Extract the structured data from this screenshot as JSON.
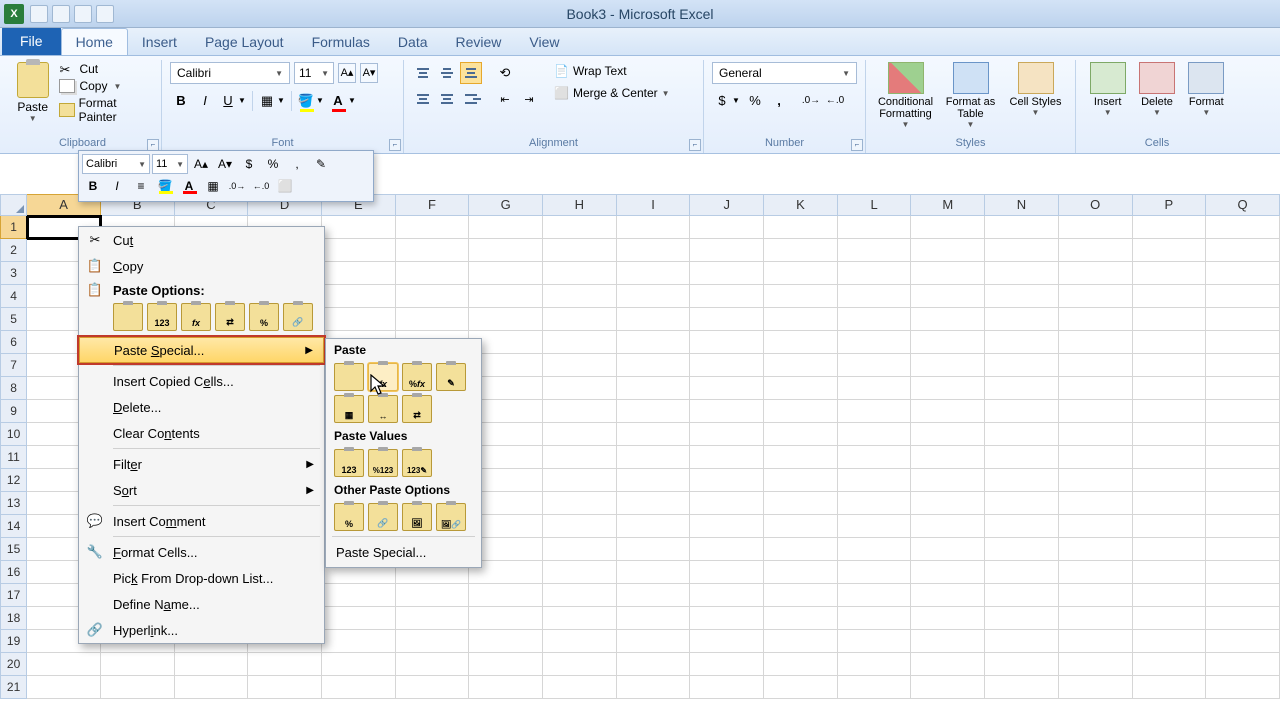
{
  "title": "Book3 - Microsoft Excel",
  "tabs": {
    "file": "File",
    "home": "Home",
    "insert": "Insert",
    "page_layout": "Page Layout",
    "formulas": "Formulas",
    "data": "Data",
    "review": "Review",
    "view": "View"
  },
  "ribbon": {
    "clipboard": {
      "label": "Clipboard",
      "paste": "Paste",
      "cut": "Cut",
      "copy": "Copy",
      "format_painter": "Format Painter"
    },
    "font": {
      "label": "Font",
      "name": "Calibri",
      "size": "11"
    },
    "alignment": {
      "label": "Alignment",
      "wrap": "Wrap Text",
      "merge": "Merge & Center"
    },
    "number": {
      "label": "Number",
      "format": "General"
    },
    "styles": {
      "label": "Styles",
      "cf": "Conditional Formatting",
      "ft": "Format as Table",
      "cs": "Cell Styles"
    },
    "cells": {
      "label": "Cells",
      "insert": "Insert",
      "delete": "Delete",
      "format": "Format"
    }
  },
  "mini_toolbar": {
    "font": "Calibri",
    "size": "11"
  },
  "columns": [
    "A",
    "B",
    "C",
    "D",
    "E",
    "F",
    "G",
    "H",
    "I",
    "J",
    "K",
    "L",
    "M",
    "N",
    "O",
    "P",
    "Q"
  ],
  "rows": [
    1,
    2,
    3,
    4,
    5,
    6,
    7,
    8,
    9,
    10,
    11,
    12,
    13,
    14,
    15,
    16,
    17,
    18,
    19,
    20,
    21
  ],
  "context_menu": {
    "cut": "Cut",
    "copy": "Copy",
    "paste_options": "Paste Options:",
    "paste_special": "Paste Special...",
    "insert_copied": "Insert Copied Cells...",
    "delete": "Delete...",
    "clear_contents": "Clear Contents",
    "filter": "Filter",
    "sort": "Sort",
    "insert_comment": "Insert Comment",
    "format_cells": "Format Cells...",
    "pick_dropdown": "Pick From Drop-down List...",
    "define_name": "Define Name...",
    "hyperlink": "Hyperlink..."
  },
  "submenu": {
    "paste": "Paste",
    "paste_values": "Paste Values",
    "other": "Other Paste Options",
    "paste_special": "Paste Special..."
  }
}
